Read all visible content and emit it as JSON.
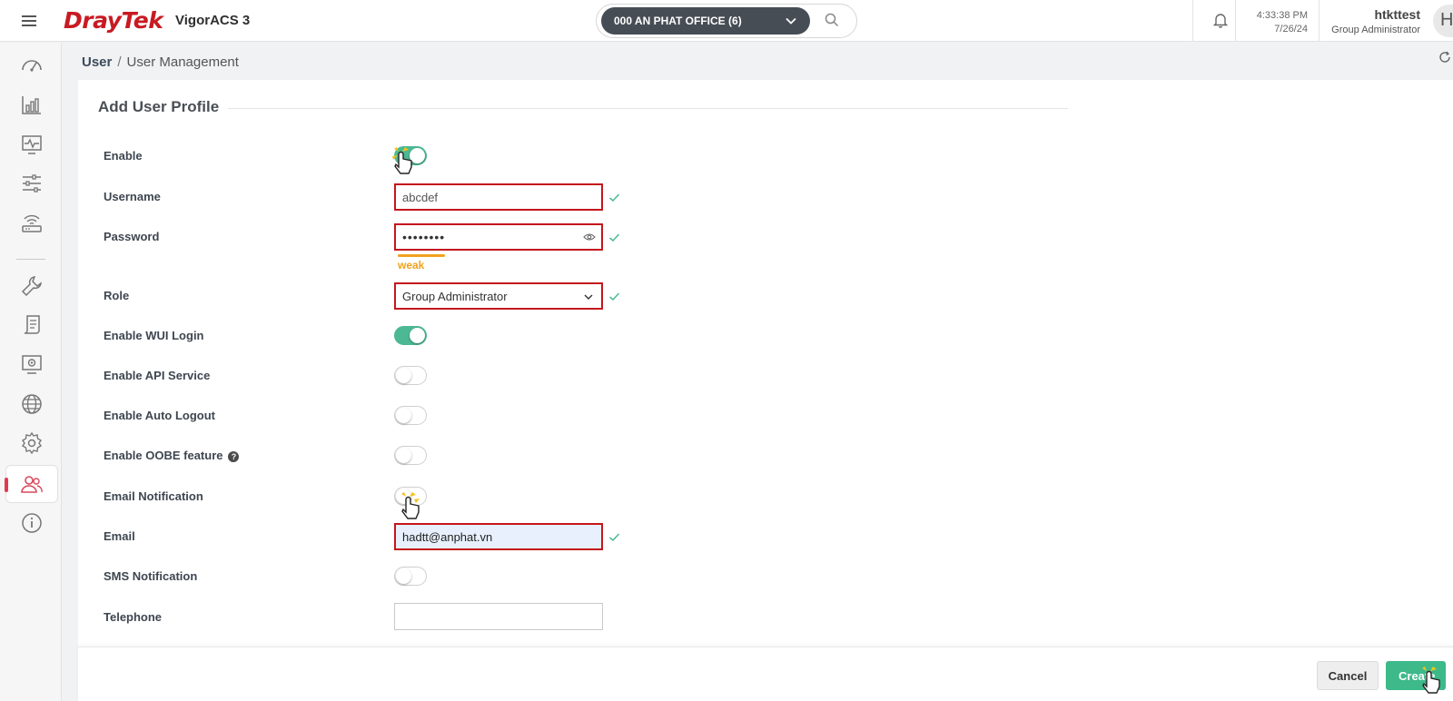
{
  "app": {
    "brand": "DrayTek",
    "product": "VigorACS 3",
    "group_selector": "000 AN PHAT OFFICE (6)",
    "time": "4:33:38 PM",
    "date": "7/26/24",
    "user_name": "htkttest",
    "user_role": "Group Administrator",
    "avatar_letter": "H"
  },
  "sidebar": {
    "items": [
      {
        "icon": "dashboard-gauge-icon",
        "active": false
      },
      {
        "icon": "bar-chart-icon",
        "active": false
      },
      {
        "icon": "monitor-pulse-icon",
        "active": false
      },
      {
        "icon": "sliders-icon",
        "active": false
      },
      {
        "icon": "router-wifi-icon",
        "active": false
      },
      {
        "icon": "wrench-icon",
        "active": false
      },
      {
        "icon": "scroll-document-icon",
        "active": false
      },
      {
        "icon": "screen-gear-icon",
        "active": false
      },
      {
        "icon": "globe-icon",
        "active": false
      },
      {
        "icon": "gear-icon",
        "active": false
      },
      {
        "icon": "users-icon",
        "active": true
      },
      {
        "icon": "info-icon",
        "active": false
      }
    ]
  },
  "breadcrumb": {
    "root": "User",
    "separator": "/",
    "current": "User Management"
  },
  "form": {
    "title": "Add User Profile",
    "enable": {
      "label": "Enable",
      "on": true
    },
    "username": {
      "label": "Username",
      "value": "abcdef"
    },
    "password": {
      "label": "Password",
      "masked_value": "••••••••",
      "strength": "weak"
    },
    "role": {
      "label": "Role",
      "value": "Group Administrator"
    },
    "enable_wui_login": {
      "label": "Enable WUI Login",
      "on": true
    },
    "enable_api_service": {
      "label": "Enable API Service",
      "on": false
    },
    "enable_auto_logout": {
      "label": "Enable Auto Logout",
      "on": false
    },
    "enable_oobe": {
      "label": "Enable OOBE feature",
      "on": false
    },
    "email_notification": {
      "label": "Email Notification",
      "on": false
    },
    "email": {
      "label": "Email",
      "value": "hadtt@anphat.vn"
    },
    "sms_notification": {
      "label": "SMS Notification",
      "on": false
    },
    "telephone": {
      "label": "Telephone",
      "value": ""
    }
  },
  "actions": {
    "cancel": "Cancel",
    "create": "Create"
  },
  "colors": {
    "brand_red": "#c81a22",
    "accent_green": "#4cb894",
    "error_border": "#c4161c",
    "strength_weak": "#f0a21d",
    "active_marker": "#e23a50"
  }
}
